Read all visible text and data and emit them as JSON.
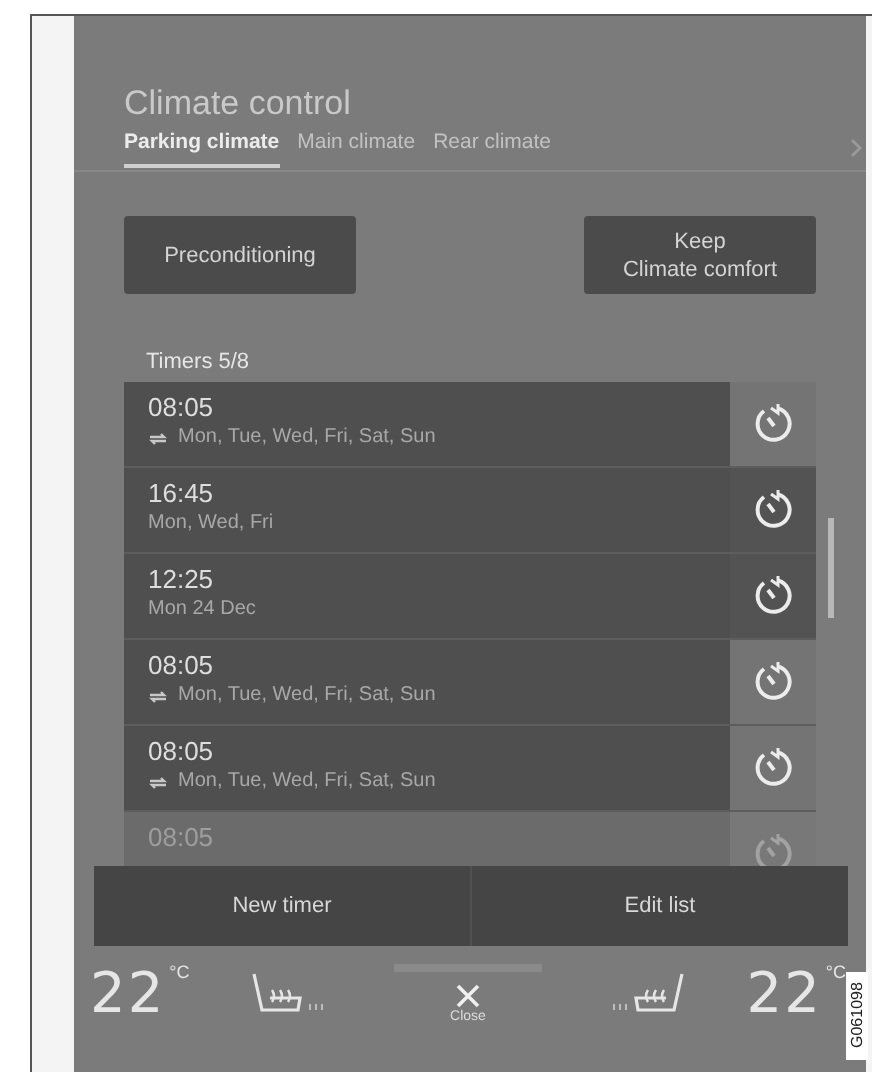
{
  "title": "Climate control",
  "tabs": [
    {
      "label": "Parking climate",
      "selected": true
    },
    {
      "label": "Main climate",
      "selected": false
    },
    {
      "label": "Rear climate",
      "selected": false
    }
  ],
  "buttons": [
    "Preconditioning",
    "Keep\nClimate comfort"
  ],
  "timers": {
    "label": "Timers 5/8",
    "items": [
      {
        "time": "08:05",
        "repeat": true,
        "days": "Mon, Tue, Wed, Fri, Sat, Sun",
        "highlighted": false,
        "faded": false
      },
      {
        "time": "16:45",
        "repeat": false,
        "days": "Mon, Wed, Fri",
        "highlighted": true,
        "faded": false
      },
      {
        "time": "12:25",
        "repeat": false,
        "days": "Mon 24 Dec",
        "highlighted": true,
        "faded": false
      },
      {
        "time": "08:05",
        "repeat": true,
        "days": "Mon, Tue, Wed, Fri, Sat, Sun",
        "highlighted": false,
        "faded": false
      },
      {
        "time": "08:05",
        "repeat": true,
        "days": "Mon, Tue, Wed, Fri, Sat, Sun",
        "highlighted": false,
        "faded": false
      },
      {
        "time": "08:05",
        "highlighted": false,
        "faded": true
      }
    ]
  },
  "actions": [
    "New timer",
    "Edit list"
  ],
  "climate_bar": {
    "left_temp": "22",
    "left_unit": "°C",
    "close": "Close",
    "right_temp": "22",
    "right_unit": "°C"
  },
  "figure_id": "G061098"
}
